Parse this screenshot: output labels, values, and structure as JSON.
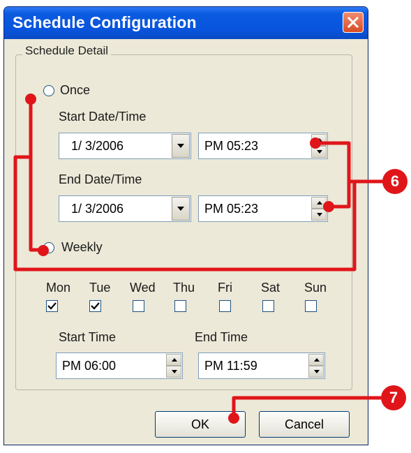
{
  "window": {
    "title": "Schedule Configuration"
  },
  "group": {
    "label": "Schedule Detail"
  },
  "once": {
    "label": "Once",
    "selected": false
  },
  "start": {
    "label": "Start Date/Time",
    "date": "1/ 3/2006",
    "time": "PM 05:23"
  },
  "end": {
    "label": "End Date/Time",
    "date": "1/ 3/2006",
    "time": "PM 05:23"
  },
  "weekly": {
    "label": "Weekly",
    "selected": true
  },
  "days": [
    {
      "label": "Mon",
      "checked": true
    },
    {
      "label": "Tue",
      "checked": true
    },
    {
      "label": "Wed",
      "checked": false
    },
    {
      "label": "Thu",
      "checked": false
    },
    {
      "label": "Fri",
      "checked": false
    },
    {
      "label": "Sat",
      "checked": false
    },
    {
      "label": "Sun",
      "checked": false
    }
  ],
  "weekly_times": {
    "start_label": "Start Time",
    "start_value": "PM 06:00",
    "end_label": "End Time",
    "end_value": "PM 11:59"
  },
  "buttons": {
    "ok": "OK",
    "cancel": "Cancel"
  },
  "callouts": {
    "six": "6",
    "seven": "7"
  },
  "colors": {
    "titlebar": "#0854dd",
    "dialog_bg": "#ece9d8",
    "annotation": "#e0151a"
  }
}
